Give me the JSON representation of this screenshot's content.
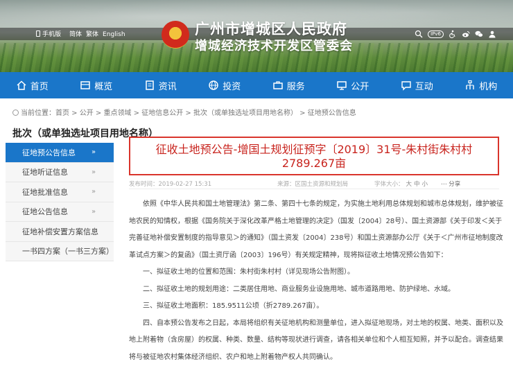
{
  "header": {
    "title_line1": "广州市增城区人民政府",
    "title_line2": "增城经济技术开发区管委会",
    "topbar_links": [
      "手机版",
      "简体",
      "繁体",
      "English"
    ],
    "topbar_right": {
      "ipv6": "IPv6"
    }
  },
  "nav": [
    {
      "label": "首页",
      "icon": "home-icon"
    },
    {
      "label": "概览",
      "icon": "overview-icon"
    },
    {
      "label": "资讯",
      "icon": "news-icon"
    },
    {
      "label": "投资",
      "icon": "globe-icon"
    },
    {
      "label": "服务",
      "icon": "service-icon"
    },
    {
      "label": "公开",
      "icon": "monitor-icon"
    },
    {
      "label": "互动",
      "icon": "chat-icon"
    },
    {
      "label": "机构",
      "icon": "org-icon"
    }
  ],
  "breadcrumb": {
    "prefix": "当前位置：",
    "items": [
      "首页",
      "公开",
      "重点领域",
      "征地信息公开",
      "批次（或单独选址项目用地名称）",
      "征地预公告信息"
    ]
  },
  "section_title": "批次（或单独选址项目用地名称）",
  "sidebar": {
    "items": [
      {
        "label": "征地预公告信息",
        "active": true
      },
      {
        "label": "征地听证信息",
        "active": false
      },
      {
        "label": "征地批准信息",
        "active": false
      },
      {
        "label": "征地公告信息",
        "active": false
      },
      {
        "label": "征地补偿安置方案信息",
        "active": false
      },
      {
        "label": "一书四方案（一书三方案）",
        "active": false
      }
    ],
    "chevron": "»"
  },
  "article": {
    "title_line1": "征收土地预公告-增国土规划征预字〔2019〕31号-朱村街朱村村",
    "title_line2": "2789.267亩",
    "date": "发布时间：2019-02-27 15:31",
    "source": "来源：区国土资源和规划局",
    "font_label": "字体大小：",
    "font_sizes": [
      "大",
      "中",
      "小"
    ],
    "share": "分享",
    "paragraphs": [
      [
        "依照《中华人民共和国土地管理法》第二条、第四十七条的规定，为实施土地利用总体规划和城市总体规划，维护被征",
        "地农民的知情权，根据《国务院关于深化改革严格土地管理的决定》（国发〔2004〕28号）、国土资源部《关于印发＜关于",
        "完善征地补偿安置制度的指导意见＞的通知》（国土资发〔2004〕238号）和国土资源部办公厅《关于＜广州市征地制度改",
        "革试点方案＞的复函》（国土资厅函〔2003〕196号）有关规定精神，现将拟征收土地情况预公告如下："
      ],
      [
        "一、拟征收土地的位置和范围：朱村街朱村村（详见现场公告附图）。"
      ],
      [
        "二、拟征收土地的规划用途：二类居住用地、商业服务业设施用地、城市道路用地、防护绿地、水域。"
      ],
      [
        "三、拟征收土地面积：185.9511公顷（折2789.267亩）。"
      ],
      [
        "四、自本预公告发布之日起，本局将组织有关征地机构和测量单位，进入拟征地现场，对土地的权属、地类、面积以及",
        "地上附着物（含房屋）的权属、种类、数量、结构等现状进行调查，请各相关单位和个人相互知照，并予以配合。调查结果",
        "将与被征地农村集体经济组织、农户和地上附着物产权人共同确认。"
      ]
    ]
  },
  "colors": {
    "nav_bg": "#1a76c9",
    "headline_red": "#c8231d",
    "border_red": "#d9342b"
  }
}
